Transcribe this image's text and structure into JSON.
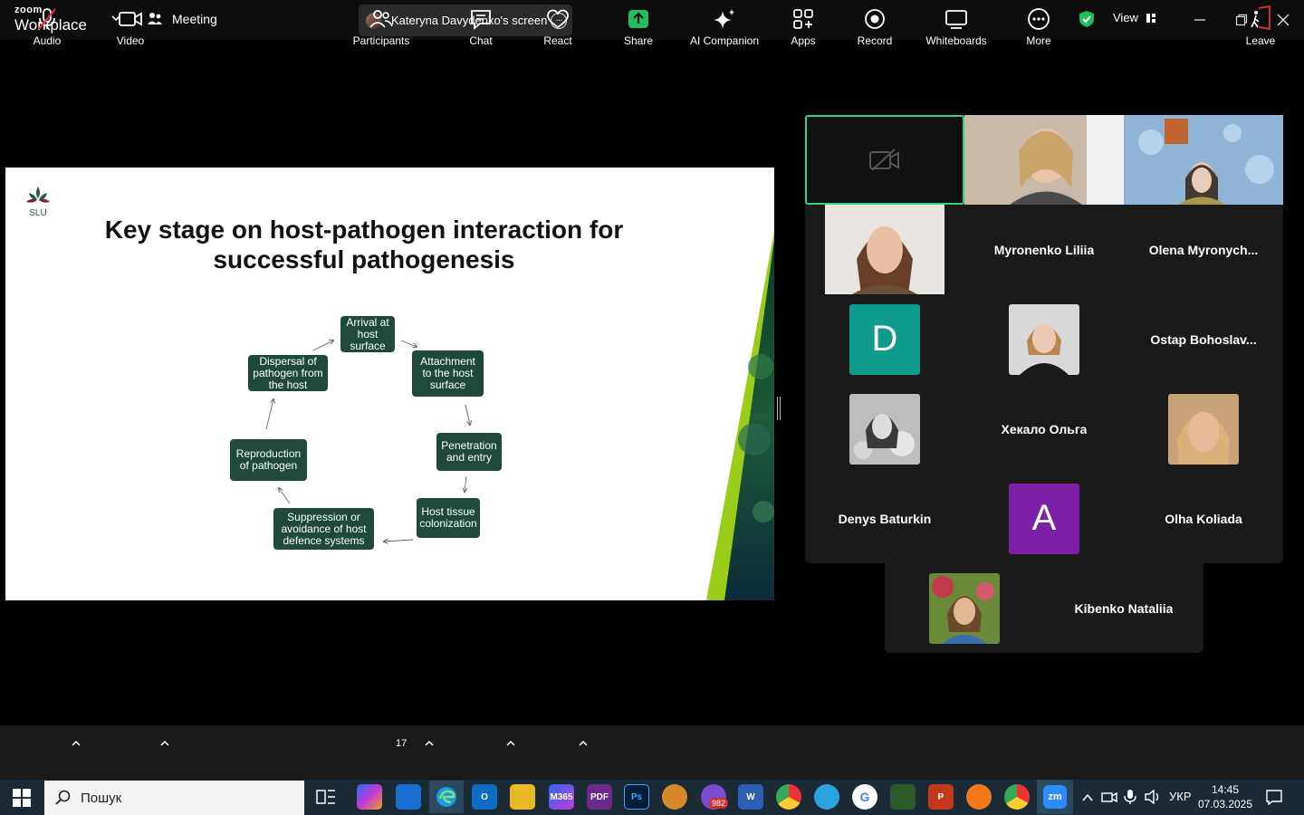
{
  "topbar": {
    "brand_small": "zoom",
    "brand_large": "Workplace",
    "meeting_label": "Meeting",
    "screen_share_label": "Kateryna Davydenko's screen",
    "more_label": "···",
    "view_label": "View",
    "shield_color": "#1fbf5f"
  },
  "slide": {
    "logo_text": "SLU",
    "title_line1": "Key stage on host-pathogen interaction for",
    "title_line2": "successful pathogenesis",
    "node_color": "#1f4a3a",
    "nodes": [
      "Arrival at host surface",
      "Attachment to the host surface",
      "Penetration and entry",
      "Host tissue colonization",
      "Suppression or avoidance of host defence systems",
      "Reproduction of pathogen",
      "Dispersal of pathogen from the host"
    ]
  },
  "gallery": {
    "participants": [
      "Myronenko Liliia",
      "Olena  Myronych...",
      "Ostap  Bohoslav...",
      "Хекало Ольга",
      "Denys Baturkin",
      "Olha Koliada",
      "Kibenko Nataliia"
    ],
    "avatar_letters": [
      "D",
      "A"
    ],
    "active_speaker_color": "#2fd286"
  },
  "toolbar": {
    "audio": "Audio",
    "video": "Video",
    "participants": "Participants",
    "participants_count": "17",
    "chat": "Chat",
    "react": "React",
    "share": "Share",
    "ai_companion": "AI Companion",
    "apps": "Apps",
    "record": "Record",
    "whiteboards": "Whiteboards",
    "more": "More",
    "leave": "Leave",
    "share_color": "#1fbf5f"
  },
  "taskbar": {
    "search_placeholder": "Пошук",
    "language": "УКР",
    "time": "14:45",
    "date": "07.03.2025",
    "viber_badge": "982",
    "zoom_label": "zm",
    "m365_label": "M365",
    "photoshop_label": "Ps",
    "pdf_label": "PDF",
    "word_label": "W"
  }
}
